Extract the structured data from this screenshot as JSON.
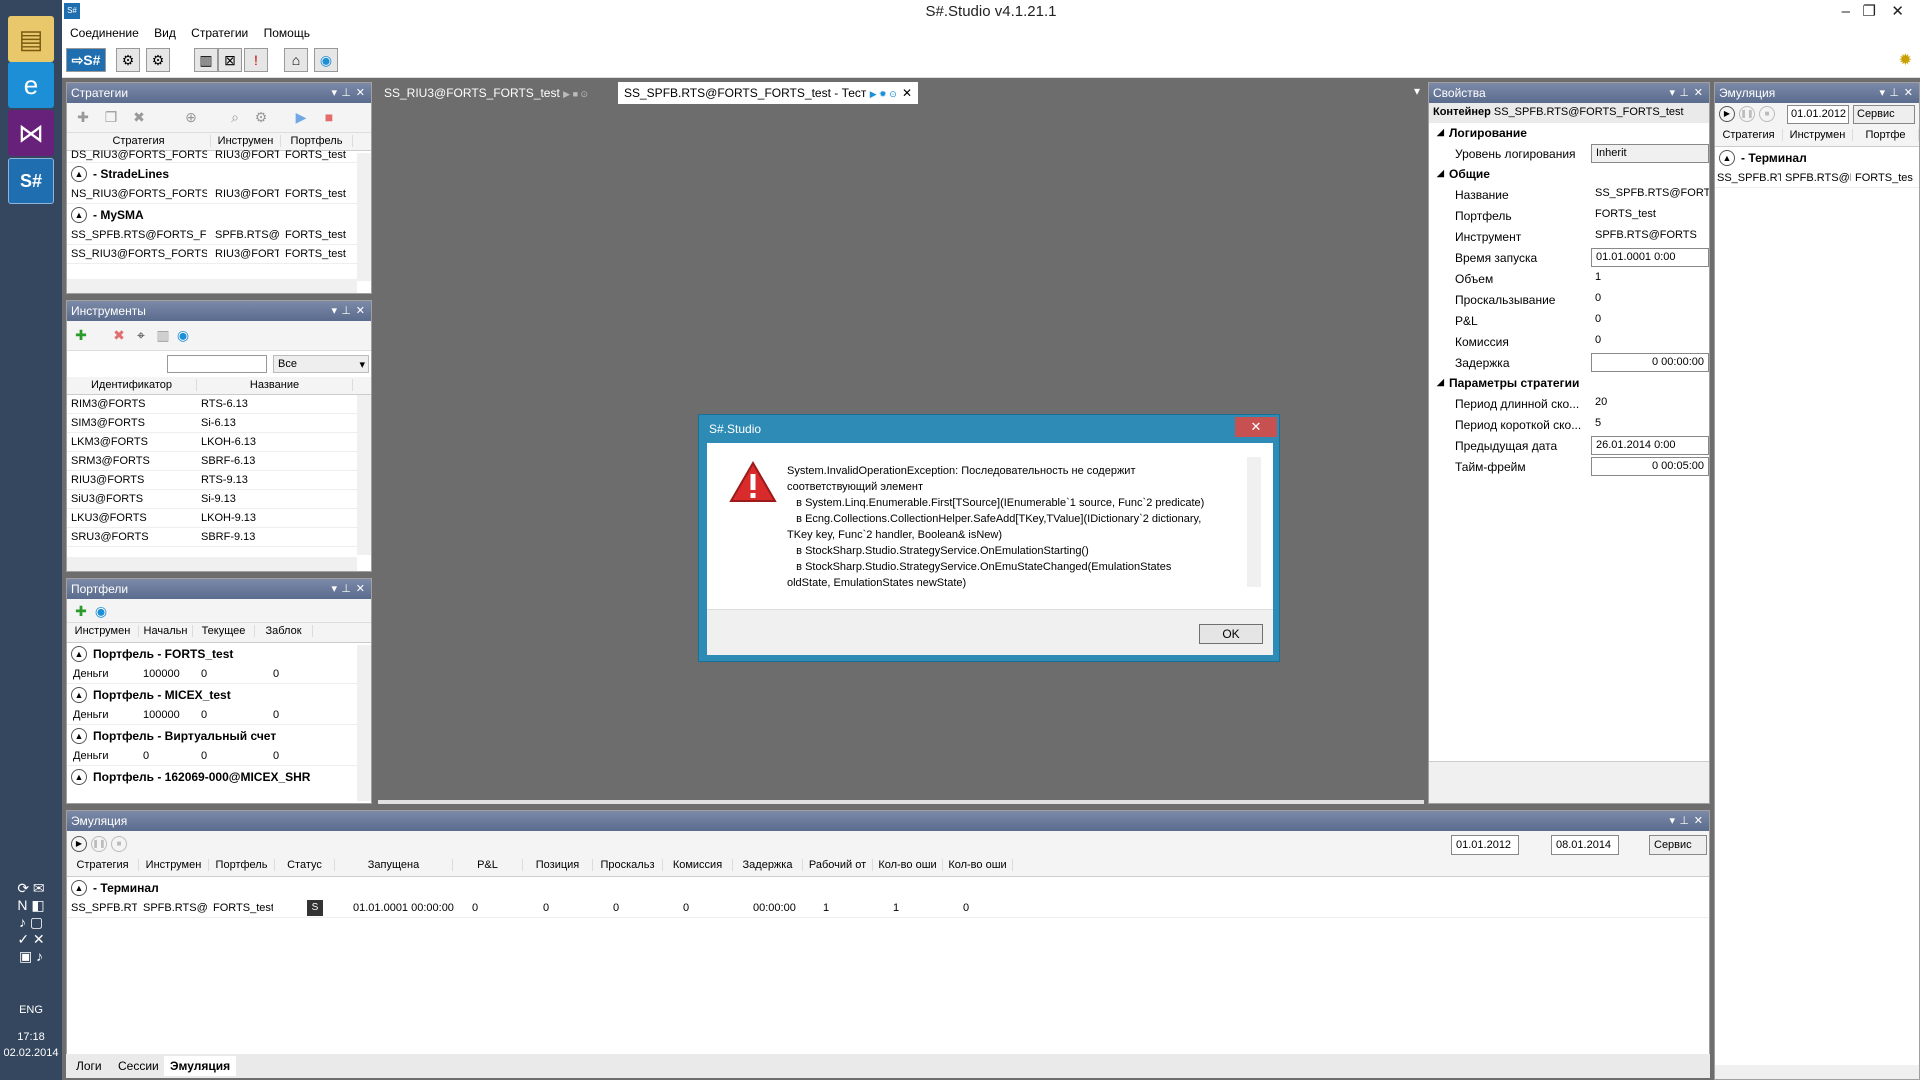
{
  "window": {
    "title": "S#.Studio v4.1.21.1"
  },
  "menu": [
    "Соединение",
    "Вид",
    "Стратегии",
    "Помощь"
  ],
  "taskbar": {
    "lang": "ENG",
    "time": "17:18",
    "date": "02.02.2014"
  },
  "strategies_panel": {
    "title": "Стратегии",
    "columns": [
      "Стратегия",
      "Инструмен",
      "Портфель"
    ],
    "top_row": [
      "DS_RIU3@FORTS_FORTS_",
      "RIU3@FORT",
      "FORTS_test"
    ],
    "groups": [
      {
        "name": "- StradeLines",
        "rows": [
          [
            "NS_RIU3@FORTS_FORTS_",
            "RIU3@FORT",
            "FORTS_test"
          ]
        ]
      },
      {
        "name": "- MySMA",
        "rows": [
          [
            "SS_SPFB.RTS@FORTS_FOF",
            "SPFB.RTS@F",
            "FORTS_test"
          ],
          [
            "SS_RIU3@FORTS_FORTS_t",
            "RIU3@FORT",
            "FORTS_test"
          ]
        ]
      }
    ]
  },
  "instruments_panel": {
    "title": "Инструменты",
    "filter": "Все",
    "columns": [
      "Идентификатор",
      "Название"
    ],
    "rows": [
      [
        "RIM3@FORTS",
        "RTS-6.13"
      ],
      [
        "SIM3@FORTS",
        "Si-6.13"
      ],
      [
        "LKM3@FORTS",
        "LKOH-6.13"
      ],
      [
        "SRM3@FORTS",
        "SBRF-6.13"
      ],
      [
        "RIU3@FORTS",
        "RTS-9.13"
      ],
      [
        "SiU3@FORTS",
        "Si-9.13"
      ],
      [
        "LKU3@FORTS",
        "LKOH-9.13"
      ],
      [
        "SRU3@FORTS",
        "SBRF-9.13"
      ]
    ]
  },
  "portfolios_panel": {
    "title": "Портфели",
    "columns": [
      "Инструмен",
      "Начальн",
      "Текущее",
      "Заблок"
    ],
    "groups": [
      {
        "name": "Портфель - FORTS_test",
        "row": [
          "Деньги",
          "100000",
          "0",
          "0"
        ]
      },
      {
        "name": "Портфель - MICEX_test",
        "row": [
          "Деньги",
          "100000",
          "0",
          "0"
        ]
      },
      {
        "name": "Портфель - Виртуальный счет",
        "row": [
          "Деньги",
          "0",
          "0",
          "0"
        ]
      },
      {
        "name": "Портфель - 162069-000@MICEX_SHR",
        "row": [
          "",
          "",
          "",
          ""
        ]
      }
    ]
  },
  "doc_tabs": [
    "SS_RIU3@FORTS_FORTS_test",
    "SS_SPFB.RTS@FORTS_FORTS_test - Тест"
  ],
  "properties_panel": {
    "title": "Свойства",
    "container_label": "Контейнер",
    "container_value": "SS_SPFB.RTS@FORTS_FORTS_test",
    "sections": [
      {
        "name": "Логирование",
        "rows": [
          [
            "Уровень логирования",
            "Inherit"
          ]
        ]
      },
      {
        "name": "Общие",
        "rows": [
          [
            "Название",
            "SS_SPFB.RTS@FORTS_"
          ],
          [
            "Портфель",
            "FORTS_test"
          ],
          [
            "Инструмент",
            "SPFB.RTS@FORTS"
          ],
          [
            "Время запуска",
            "01.01.0001 0:00"
          ],
          [
            "Объем",
            "1"
          ],
          [
            "Проскальзывание",
            "0"
          ],
          [
            "P&L",
            "0"
          ],
          [
            "Комиссия",
            "0"
          ],
          [
            "Задержка",
            "0 00:00:00"
          ]
        ]
      },
      {
        "name": "Параметры стратегии",
        "rows": [
          [
            "Период длинной ско...",
            "20"
          ],
          [
            "Период короткой ско...",
            "5"
          ],
          [
            "Предыдущая дата",
            "26.01.2014 0:00"
          ],
          [
            "Тайм-фрейм",
            "0 00:05:00"
          ]
        ]
      }
    ]
  },
  "emulation_right": {
    "title": "Эмуляция",
    "date": "01.01.2012",
    "service": "Сервис",
    "columns": [
      "Стратегия",
      "Инструмен",
      "Портфе"
    ],
    "group": "- Терминал",
    "row": [
      "SS_SPFB.RTS",
      "SPFB.RTS@F",
      "FORTS_tes"
    ]
  },
  "dialog": {
    "title": "S#.Studio",
    "close": "✕",
    "message": "System.InvalidOperationException: Последовательность не содержит\nсоответствующий элемент\n   в System.Linq.Enumerable.First[TSource](IEnumerable`1 source, Func`2 predicate)\n   в Ecng.Collections.CollectionHelper.SafeAdd[TKey,TValue](IDictionary`2 dictionary,\nTKey key, Func`2 handler, Boolean& isNew)\n   в StockSharp.Studio.StrategyService.OnEmulationStarting()\n   в StockSharp.Studio.StrategyService.OnEmuStateChanged(EmulationStates\noldState, EmulationStates newState)",
    "ok": "OK"
  },
  "emulation_bottom": {
    "title": "Эмуляция",
    "date_from": "01.01.2012",
    "date_to": "08.01.2014",
    "service": "Сервис",
    "columns": [
      "Стратегия",
      "Инструмен",
      "Портфель",
      "Статус",
      "Запущена",
      "P&L",
      "Позиция",
      "Проскальз",
      "Комиссия",
      "Задержка",
      "Рабочий от",
      "Кол-во оши",
      "Кол-во оши"
    ],
    "group": "- Терминал",
    "row": [
      "SS_SPFB.RTS",
      "SPFB.RTS@F",
      "FORTS_test",
      "S",
      "01.01.0001 00:00:00",
      "0",
      "0",
      "0",
      "0",
      "00:00:00",
      "1",
      "1",
      "0"
    ],
    "tabs": [
      "Логи",
      "Сессии",
      "Эмуляция"
    ]
  }
}
